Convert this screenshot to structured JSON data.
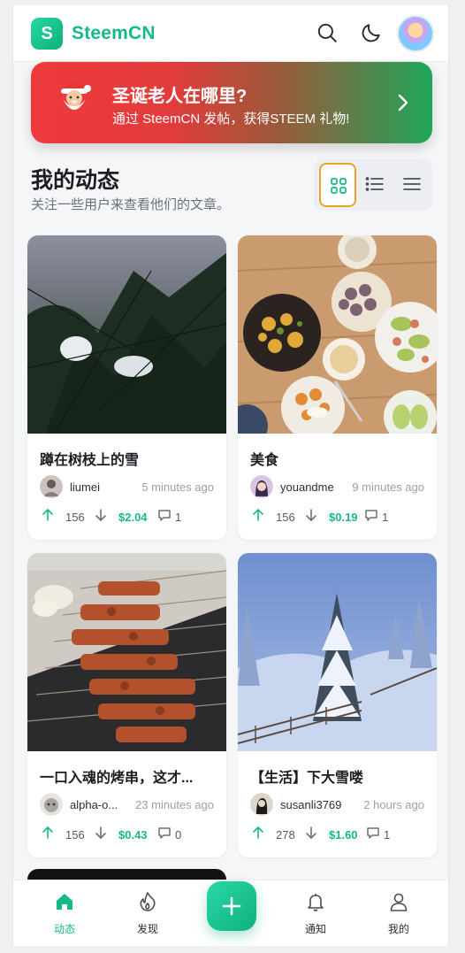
{
  "app": {
    "logo_letter": "S",
    "name": "SteemCN"
  },
  "header": {
    "search_icon": "search-icon",
    "theme_icon": "moon-icon",
    "avatar_icon": "user-avatar"
  },
  "banner": {
    "title": "圣诞老人在哪里?",
    "subtitle": "通过 SteemCN 发帖，获得STEEM 礼物!",
    "icon": "santa-icon",
    "arrow_icon": "chevron-right-icon"
  },
  "section": {
    "title": "我的动态",
    "subtitle": "关注一些用户来查看他们的文章。",
    "view_modes": [
      "grid-view-icon",
      "list-view-icon",
      "compact-view-icon"
    ],
    "active_view": "grid"
  },
  "posts": [
    {
      "title": "蹲在树枝上的雪",
      "author": "liumei",
      "time": "5 minutes ago",
      "votes": "156",
      "payout": "$2.04",
      "comments": "1"
    },
    {
      "title": "美食",
      "author": "youandme",
      "time": "9 minutes ago",
      "votes": "156",
      "payout": "$0.19",
      "comments": "1"
    },
    {
      "title": "一口入魂的烤串，这才...",
      "author": "alpha-o...",
      "time": "23 minutes ago",
      "votes": "156",
      "payout": "$0.43",
      "comments": "0"
    },
    {
      "title": "【生活】下大雪喽",
      "author": "susanli3769",
      "time": "2 hours ago",
      "votes": "278",
      "payout": "$1.60",
      "comments": "1"
    }
  ],
  "nav": {
    "items": [
      {
        "label": "动态",
        "icon": "home-icon"
      },
      {
        "label": "发现",
        "icon": "flame-icon"
      },
      {
        "label": "通知",
        "icon": "bell-icon"
      },
      {
        "label": "我的",
        "icon": "user-icon"
      }
    ],
    "active": "动态",
    "fab_icon": "plus-icon"
  },
  "colors": {
    "brand": "#16b886",
    "banner_start": "#ef3a3d",
    "banner_end": "#1fa65a",
    "active_view_border": "#e8a42a"
  }
}
